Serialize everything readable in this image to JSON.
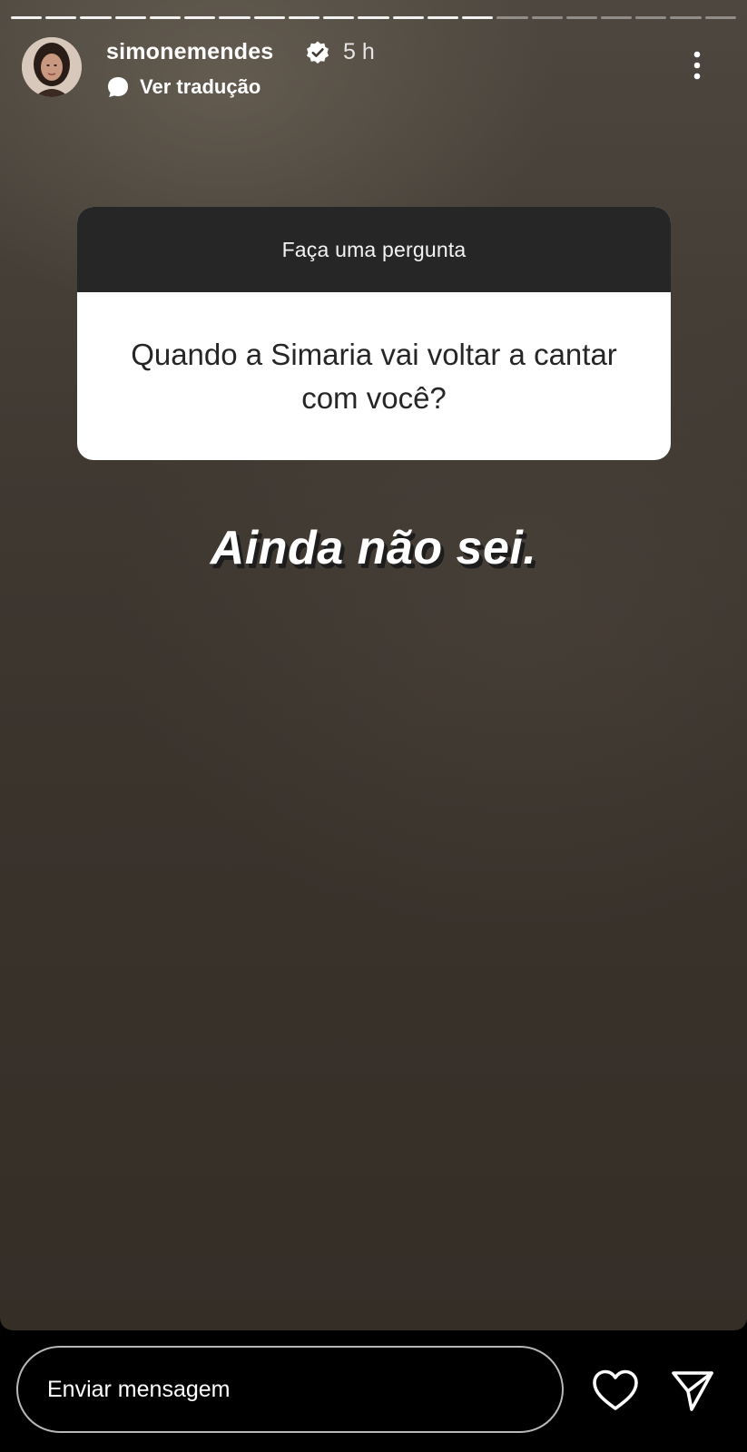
{
  "story": {
    "progress_segments_total": 21,
    "progress_segments_done": 14
  },
  "header": {
    "username": "simonemendes",
    "verified_icon": "verified-badge-icon",
    "time": "5 h",
    "translate_label": "Ver tradução",
    "more_icon": "more-vertical-icon"
  },
  "question_sticker": {
    "title": "Faça uma pergunta",
    "question": "Quando a Simaria vai voltar a cantar com você?"
  },
  "answer_text": "Ainda não sei.",
  "footer": {
    "message_placeholder": "Enviar mensagem",
    "like_icon": "heart-icon",
    "share_icon": "send-icon"
  },
  "colors": {
    "sticker_header_bg": "#262626",
    "sticker_body_bg": "#ffffff",
    "background_tone": "#3f3932"
  }
}
